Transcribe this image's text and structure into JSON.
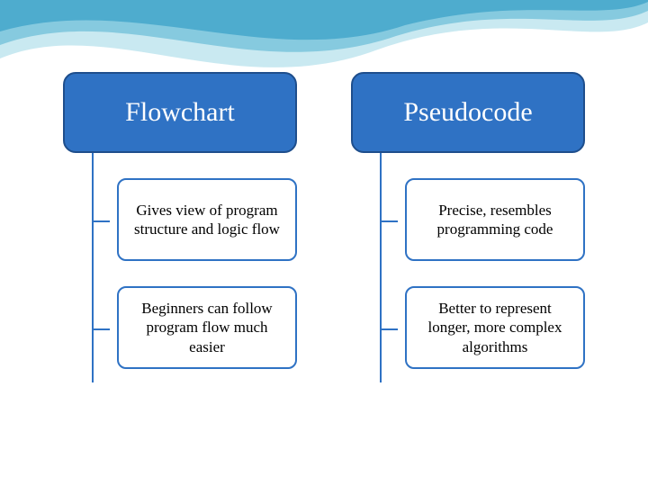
{
  "diagram": {
    "columns": [
      {
        "header": "Flowchart",
        "items": [
          "Gives view of program structure and logic flow",
          "Beginners can follow program flow much easier"
        ]
      },
      {
        "header": "Pseudocode",
        "items": [
          "Precise, resembles programming code",
          "Better to represent longer, more complex algorithms"
        ]
      }
    ]
  },
  "colors": {
    "primary": "#2f72c4",
    "primary_dark": "#1e4e8c",
    "wave_light": "#bfe5ef",
    "wave_mid": "#6fbfd8",
    "wave_dark": "#2f9bc4"
  }
}
